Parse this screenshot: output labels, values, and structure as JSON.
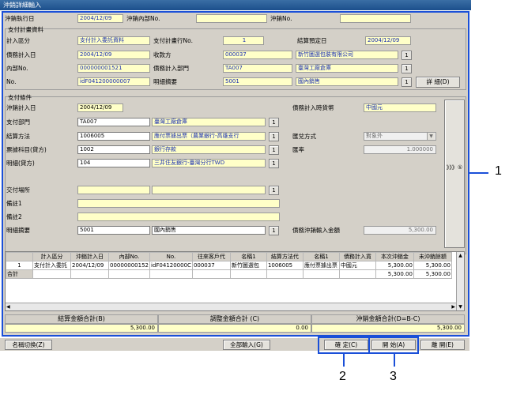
{
  "window": {
    "title": "沖銷詳細輸入"
  },
  "header": {
    "exec_date_label": "沖銷執行日",
    "exec_date": "2004/12/09",
    "internal_no_label": "沖銷內部No.",
    "internal_no": "",
    "no_label": "沖銷No.",
    "no": ""
  },
  "plan": {
    "section_label": "支付計畫資料",
    "category_label": "計入區分",
    "category": "支付計入委託資料",
    "plan_row_label": "支付計畫行No.",
    "plan_row": "1",
    "settle_date_label": "結算預定日",
    "settle_date": "2004/12/09",
    "debt_date_label": "債務計入日",
    "debt_date": "2004/12/09",
    "payee_label": "收款方",
    "payee_code": "000037",
    "payee_name": "新竹圖選包裝有限公司",
    "internal_no_label": "內部No.",
    "internal_no": "000000001521",
    "dept_label": "債務計入部門",
    "dept_code": "TA007",
    "dept_name": "臺灣工廠倉庫",
    "no_label": "No.",
    "no": "idF041200000007",
    "detail_label": "明細摘要",
    "detail_code": "5001",
    "detail_name": "國內銷售",
    "detail_button": "詳 細(D)"
  },
  "pay": {
    "section_label": "支付條件",
    "date_label": "沖銷計入日",
    "date": "2004/12/09",
    "currency_label": "債務計入時貨幣",
    "currency": "中國元",
    "dept_label": "支付部門",
    "dept_code": "TA007",
    "dept_name": "臺灣工廠倉庫",
    "method_label": "結算方法",
    "method_code": "1006005",
    "method_name": "應付票據出票（農業銀行-高雄支行",
    "exchange_label": "匯兌方式",
    "exchange_value": "對象外",
    "account_label": "票據科目(貸方)",
    "account_code": "1002",
    "account_name": "銀行存款",
    "rate_label": "匯率",
    "rate_value": "1.000000",
    "detail_label": "明細(貸方)",
    "detail_code": "104",
    "detail_name": "三井住友銀行-臺灣分行TWD",
    "place_label": "交付場所",
    "remark1_label": "備註1",
    "remark2_label": "備註2",
    "summary_label": "明細摘要",
    "summary_code": "5001",
    "summary_name": "國內銷售",
    "amount_label": "債務沖銷輸入金額",
    "amount_value": "5,300.00",
    "side_button": "》》》①"
  },
  "grid": {
    "columns": [
      "計入區分",
      "沖銷計入日",
      "內部No.",
      "No.",
      "往來客戶代",
      "名稱1",
      "結算方法代",
      "名稱1",
      "債務計入貨",
      "本次沖銷金",
      "未沖銷餘額"
    ],
    "rows": [
      [
        "1",
        "支付計入委託",
        "2004/12/09",
        "00000000152",
        "idF04120000C",
        "000037",
        "新竹圖選包",
        "1006005",
        "應付票據出票",
        "中國元",
        "5,300.00",
        "5,300.00"
      ]
    ],
    "total_label": "合計",
    "total_current": "5,300.00",
    "total_remaining": "5,300.00"
  },
  "totals": {
    "settle_label": "結算金額合計(B)",
    "settle_value": "5,300.00",
    "adjust_label": "調整金額合計 (C)",
    "adjust_value": "0.00",
    "offset_label": "沖銷金額合計(D=B-C)",
    "offset_value": "5,300.00"
  },
  "footer": {
    "name_switch": "名稱切換(Z)",
    "input_all": "全部輸入(G)",
    "confirm": "確 定(C)",
    "open": "開 始(A)",
    "close": "離 開(E)"
  },
  "callouts": {
    "one": "1",
    "two": "2",
    "three": "3"
  }
}
